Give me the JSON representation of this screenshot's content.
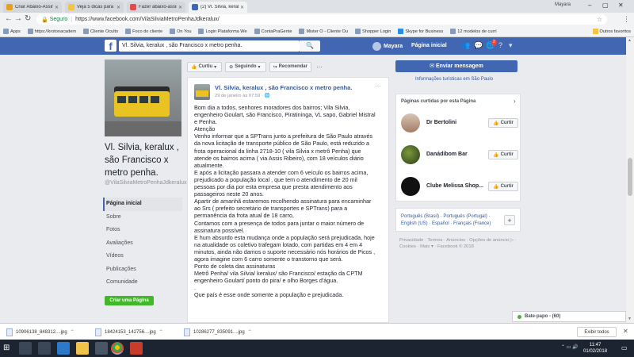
{
  "browser": {
    "tabs": [
      {
        "label": "Criar Abaixo-Assinado |",
        "active": false,
        "color": "#e7a21c"
      },
      {
        "label": "Veja 5 dicas para fazer",
        "active": false,
        "color": "#f4c542"
      },
      {
        "label": "Fazer abaixo-assinado",
        "active": false,
        "color": "#e54b4b"
      },
      {
        "label": "(2) Vl. Silvia, keralux , s",
        "active": true,
        "color": "#4267b2"
      }
    ],
    "window_user": "Mayara",
    "secure_label": "Seguro",
    "url": "https://www.facebook.com/VilaSilviaMetroPenhaJdkeralux/",
    "bookmarks": [
      "Apps",
      "https://krotonacadem",
      "Cliente Oculto",
      "Foco do cliente",
      "On You",
      "Login Plataforma We",
      "ContaPraGente",
      "Mister O - Cliente Ou",
      "Shopper Login",
      "Skype for Business",
      "12 modelos de currí"
    ],
    "bookmarks_other": "Outros favoritos"
  },
  "fb": {
    "search_value": "Vl. Silvia, keralux , são Francisco x metro penha.",
    "user_name": "Mayara",
    "home_label": "Página inicial",
    "notif_count": "2"
  },
  "page": {
    "name": "Vl. Silvia, keralux , são Francisco x metro penha.",
    "handle": "@VilaSilviaMetroPenhaJdkeralux",
    "nav": [
      "Página inicial",
      "Sobre",
      "Fotos",
      "Avaliações",
      "Vídeos",
      "Publicações",
      "Comunidade"
    ],
    "create_page": "Criar uma Página"
  },
  "actions": {
    "liked": "Curtiu",
    "following": "Seguindo",
    "recommend": "Recomendar"
  },
  "post": {
    "author": "Vl. Silvia, keralux , são Francisco x metro penha.",
    "date": "29 de janeiro às 07:59 · 🌐",
    "lines": [
      "Bom dia a todos, senhores moradores dos bairros; Vila Silvia,",
      "engenheiro Goulart, são Francisco, Piratininga, VL sapo, Gabriel Mistral",
      "e Penha.",
      "Atenção",
      "Venho informar que a SPTrans junto a prefeitura de São Paulo através",
      "da nova licitação de transporte público de São Paulo, está reduzido a",
      "frota operacional da linha 2718-10 ( vila Silvia x metrô Penha) que",
      "atende os bairros acima ( via Assis Ribeiro), com 18 veículos diário",
      "atualmente.",
      "E após a licitação passara a atender com 6 veículo os bairros acima,",
      "prejudicado a população local , que tem o atendimento de 20 mil",
      "pessoas por dia por esta empresa que presta atendimento aos",
      "passageiros neste 20 anos.",
      "Apartir de amanhã estaremos recolhendo assinatura para encaminhar",
      "ao Srs ( prefeito secretário de transportes e SPTrans) para a",
      "permanência da frota atual de 18 carro,",
      "Contamos com a presença de todos para juntar o maior número de",
      "assinatura possível.",
      "E hum absurdo esta mudança onde a população será prejudicada, hoje",
      "na atualidade os coletivo trafegam lotado, com partidas em 4 em 4",
      "minutos, ainda não damos o suporte necessário nós horários de Picos ,",
      "agora imagine com 6 carro somente o transtorno que será.",
      "Ponto de coleta das assinaturas",
      "Metrô Penha/ vila Silvia/ keralux/ são Francisco/ estação da CPTM",
      "engenheiro Goulart/ ponto do pira/ e olho Borges d'água.",
      ".",
      "Que país é esse onde somente a população e prejudicada."
    ]
  },
  "right": {
    "send_message": "Enviar mensagem",
    "tourist_info": "Informações turísticas em São Paulo",
    "liked_title": "Páginas curtidas por esta Página",
    "liked_pages": [
      {
        "name": "Dr Bertolini",
        "button": "Curtir"
      },
      {
        "name": "Danádibom Bar",
        "button": "Curtir"
      },
      {
        "name": "Clube Melissa Shop...",
        "button": "Curtir"
      }
    ],
    "languages": "Português (Brasil) · Português (Portugal) · English (US) · Español · Français (France)",
    "footer": "Privacidade · Termos · Anúncios · Opções de anúncio ▷ · Cookies · Mais ▾ · Facebook © 2018",
    "chat": "Bate-papo - (60)"
  },
  "downloads": {
    "items": [
      "10906138_848312....jpg",
      "18424153_142756....jpg",
      "10286277_835091....jpg"
    ],
    "show_all": "Exibir todos"
  },
  "taskbar": {
    "time": "11:47",
    "date": "01/02/2018"
  }
}
